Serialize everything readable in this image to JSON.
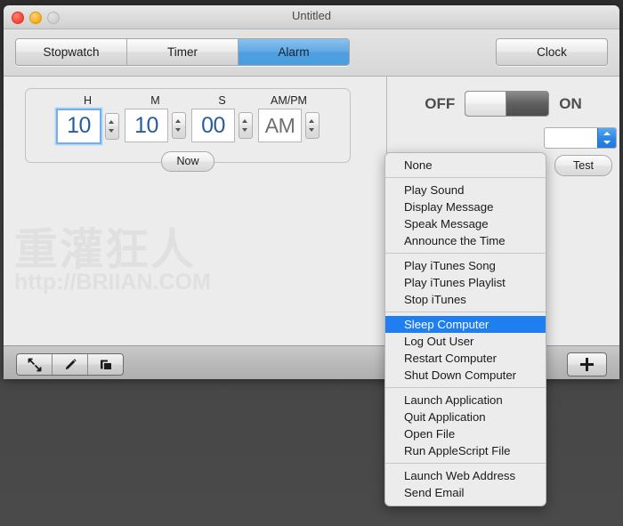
{
  "window": {
    "title": "Untitled",
    "traffic_lights": [
      "close-button",
      "minimize-button",
      "zoom-button"
    ]
  },
  "toolbar": {
    "segments": [
      {
        "label": "Stopwatch",
        "active": false
      },
      {
        "label": "Timer",
        "active": false
      },
      {
        "label": "Alarm",
        "active": true
      }
    ],
    "clock_label": "Clock",
    "active_accent": "#4f9fe0"
  },
  "time_picker": {
    "fields": [
      {
        "label": "H",
        "value": "10",
        "focused": true,
        "type": "number"
      },
      {
        "label": "M",
        "value": "10",
        "focused": false,
        "type": "number"
      },
      {
        "label": "S",
        "value": "00",
        "focused": false,
        "type": "number"
      },
      {
        "label": "AM/PM",
        "value": "AM",
        "focused": false,
        "type": "meridiem"
      }
    ],
    "now_label": "Now",
    "value_color": "#2a5d9e",
    "meridiem_color": "#6e6e6e"
  },
  "watermark": {
    "text": "重灌狂人",
    "url": "http://BRIIAN.COM"
  },
  "alarm_switch": {
    "off_label": "OFF",
    "on_label": "ON",
    "state": "OFF"
  },
  "right_pane": {
    "combo_value": "",
    "test_label": "Test"
  },
  "popup_menu": {
    "selected": "Sleep Computer",
    "highlight_color": "#1f7ef0",
    "groups": [
      {
        "items": [
          "None"
        ]
      },
      {
        "items": [
          "Play Sound",
          "Display Message",
          "Speak Message",
          "Announce the Time"
        ]
      },
      {
        "items": [
          "Play iTunes Song",
          "Play iTunes Playlist",
          "Stop iTunes"
        ]
      },
      {
        "items": [
          "Sleep Computer",
          "Log Out User",
          "Restart Computer",
          "Shut Down Computer"
        ]
      },
      {
        "items": [
          "Launch Application",
          "Quit Application",
          "Open File",
          "Run AppleScript File"
        ]
      },
      {
        "items": [
          "Launch Web Address",
          "Send Email"
        ]
      }
    ]
  },
  "bottom_bar": {
    "tools": [
      {
        "name": "resize-collapse-icon"
      },
      {
        "name": "pencil-edit-icon"
      },
      {
        "name": "duplicate-window-icon"
      }
    ],
    "add_label": "+"
  }
}
